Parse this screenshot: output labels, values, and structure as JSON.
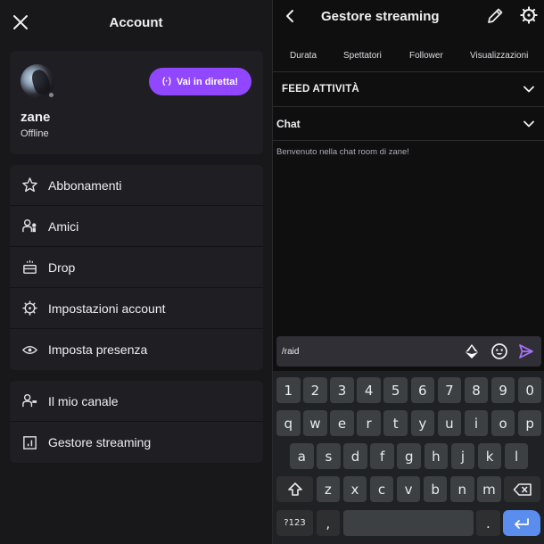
{
  "left": {
    "title": "Account",
    "close_icon": "close-icon",
    "profile": {
      "username": "zane",
      "status": "Offline",
      "live_button": {
        "icon": "broadcast-icon",
        "icon_glyph": "(·)",
        "label": "Vai in diretta!"
      }
    },
    "menu_group_1": [
      {
        "icon": "star-icon",
        "label": "Abbonamenti"
      },
      {
        "icon": "friends-icon",
        "label": "Amici"
      },
      {
        "icon": "drop-chest-icon",
        "label": "Drop"
      },
      {
        "icon": "gear-icon",
        "label": "Impostazioni account"
      },
      {
        "icon": "eye-icon",
        "label": "Imposta presenza"
      }
    ],
    "menu_group_2": [
      {
        "icon": "channel-icon",
        "label": "Il mio canale"
      },
      {
        "icon": "stream-manager-icon",
        "label": "Gestore streaming"
      }
    ]
  },
  "right": {
    "title": "Gestore streaming",
    "back_icon": "back-icon",
    "edit_icon": "pencil-icon",
    "settings_icon": "gear-icon",
    "stats_tabs": [
      "Durata",
      "Spettatori",
      "Follower",
      "Visualizzazioni"
    ],
    "activity_feed_title": "FEED ATTIVITÀ",
    "chat_title": "Chat",
    "welcome_message": "Benvenuto nella chat room di zane!",
    "chat_input": {
      "value": "/raid",
      "bits_icon": "bits-icon",
      "emote_icon": "emote-icon",
      "send_icon": "send-icon"
    }
  },
  "keyboard": {
    "row_numbers": [
      "1",
      "2",
      "3",
      "4",
      "5",
      "6",
      "7",
      "8",
      "9",
      "0"
    ],
    "row_1": [
      "q",
      "w",
      "e",
      "r",
      "t",
      "y",
      "u",
      "i",
      "o",
      "p"
    ],
    "row_2": [
      "a",
      "s",
      "d",
      "f",
      "g",
      "h",
      "j",
      "k",
      "l"
    ],
    "row_3": [
      "z",
      "x",
      "c",
      "v",
      "b",
      "n",
      "m"
    ],
    "shift_icon": "shift-icon",
    "backspace_icon": "backspace-icon",
    "symbols_label": "?123",
    "comma_label": ",",
    "period_label": ".",
    "enter_icon": "enter-icon"
  },
  "colors": {
    "accent": "#9147ff",
    "enter_key": "#5b8def",
    "panel_bg": "#18181b",
    "card_bg": "#1f1f23"
  }
}
